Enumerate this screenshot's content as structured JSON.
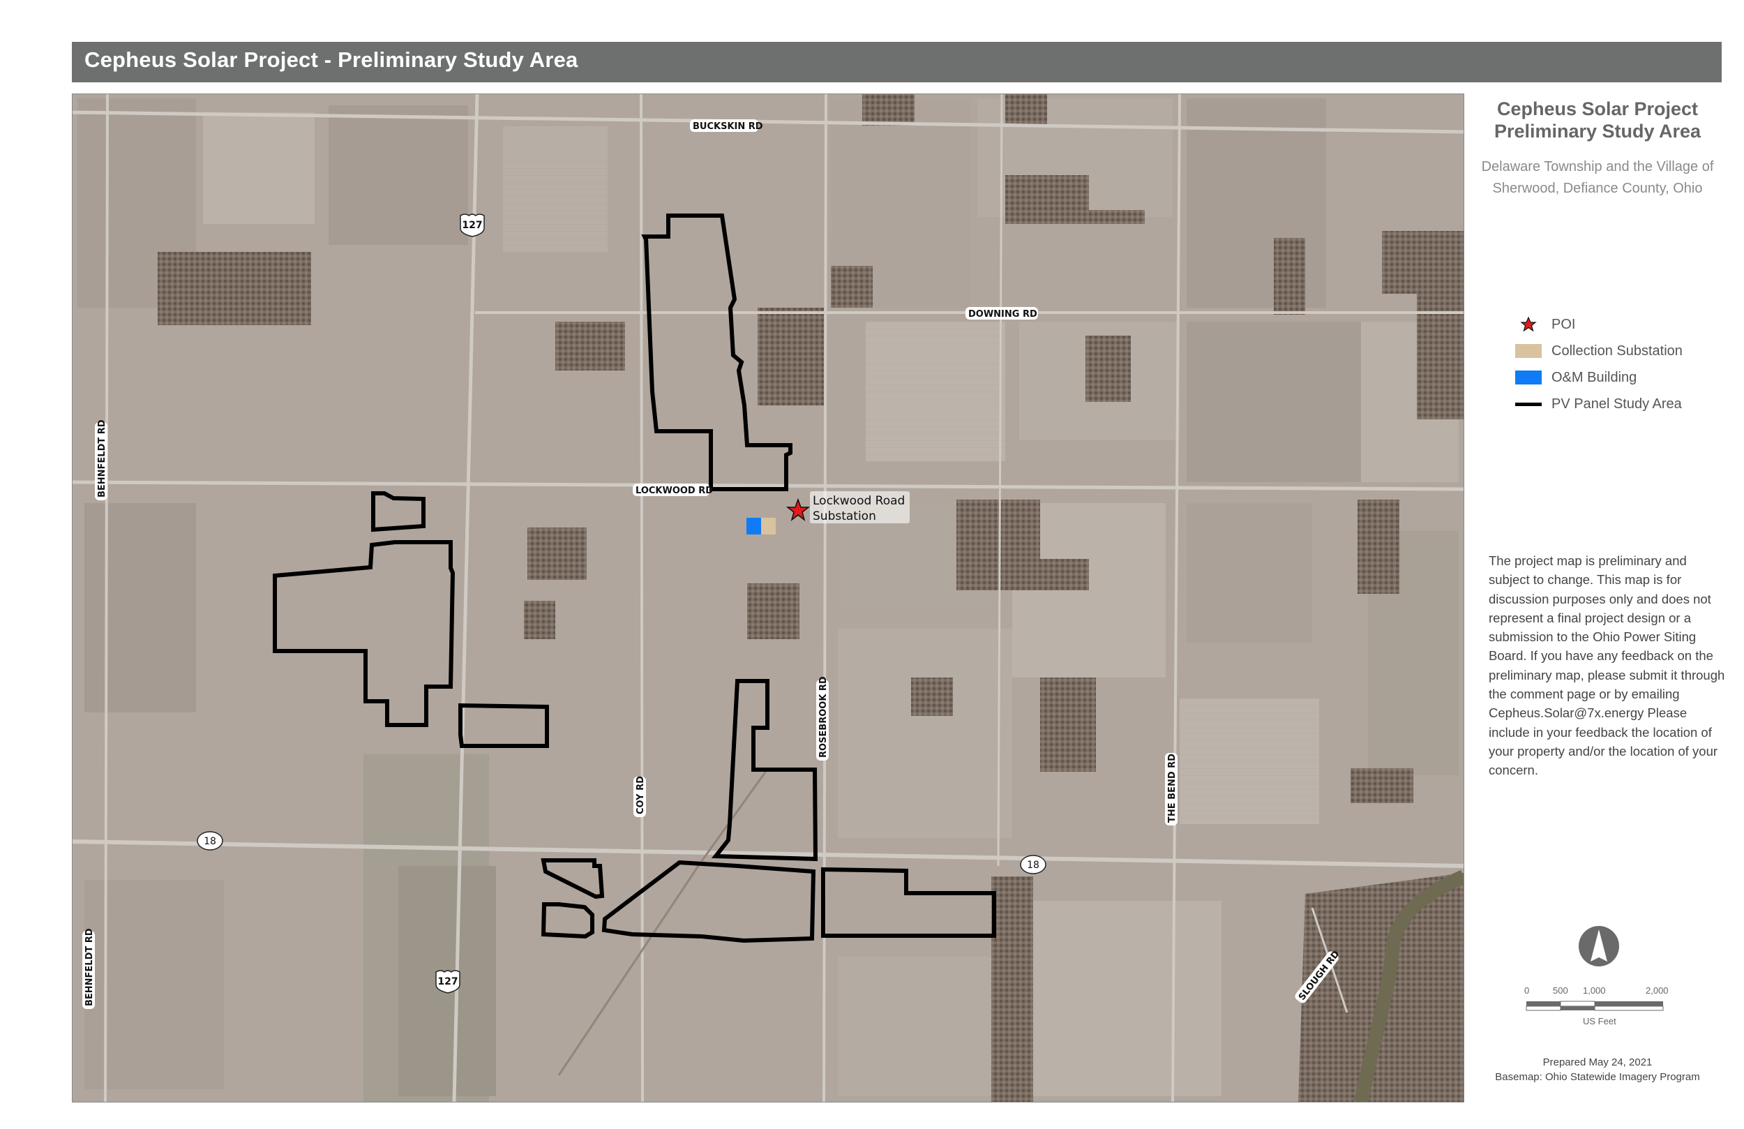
{
  "header": {
    "title": "Cepheus Solar Project - Preliminary Study Area"
  },
  "side_panel": {
    "title_line1": "Cepheus Solar Project",
    "title_line2": "Preliminary Study Area",
    "subtitle_line1": "Delaware Township and the Village of",
    "subtitle_line2": "Sherwood, Defiance County, Ohio",
    "legend": [
      {
        "symbol": "star-icon",
        "label": "POI",
        "color": "#e01b1b"
      },
      {
        "symbol": "swatch-fill",
        "label": "Collection Substation",
        "color": "#d8c39e"
      },
      {
        "symbol": "swatch-fill",
        "label": "O&M Building",
        "color": "#0f7cf5"
      },
      {
        "symbol": "line",
        "label": "PV Panel Study Area",
        "color": "#000000"
      }
    ],
    "disclaimer": "The project map is preliminary and subject to change. This map is for discussion purposes only and does not represent a final project design or a submission to the Ohio Power Siting Board. If you have any feedback on the preliminary map, please submit it through the comment page or by emailing Cepheus.Solar@7x.energy  Please include in your feedback the location of your property and/or the location of your concern.",
    "north_arrow": "north-arrow-icon",
    "scale_bar": {
      "ticks": [
        "0",
        "500",
        "1,000",
        "2,000"
      ],
      "unit": "US Feet"
    },
    "prepared": "Prepared May 24, 2021",
    "basemap": "Basemap: Ohio Statewide Imagery Program"
  },
  "map": {
    "road_labels": {
      "buckskin": "BUCKSKIN RD",
      "downing": "DOWNING RD",
      "lockwood": "LOCKWOOD RD",
      "behnfeldt_north": "BEHNFELDT RD",
      "behnfeldt_south": "BEHNFELDT RD",
      "coy": "COY RD",
      "rosebrook": "ROSEBROOK RD",
      "the_bend": "THE BEND RD",
      "slough": "SLOUGH RD"
    },
    "route_shields": {
      "us127_north": "127",
      "us127_south": "127",
      "sr18_west": "18",
      "sr18_east": "18"
    },
    "poi": {
      "label_line1": "Lockwood Road",
      "label_line2": "Substation"
    },
    "colors": {
      "poi_star": "#e01b1b",
      "collection_substation": "#d8c39e",
      "om_building": "#0f7cf5",
      "study_area_outline": "#000000"
    }
  }
}
